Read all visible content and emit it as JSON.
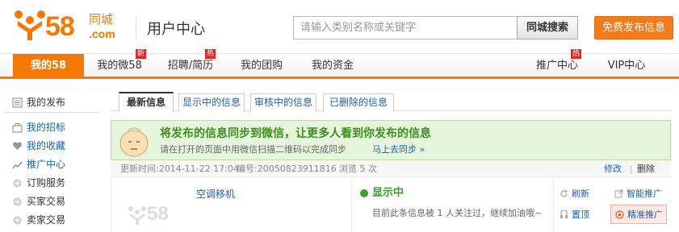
{
  "logo": {
    "number": "58",
    "cn": "同城",
    "com": ".com"
  },
  "header": {
    "page_title": "用户中心",
    "search_placeholder": "请输入类别名称或关键字",
    "search_button": "同城搜索",
    "post_button": "免费发布信息"
  },
  "nav": {
    "items": [
      {
        "label": "我的58"
      },
      {
        "label": "我的微58",
        "badge": "新"
      },
      {
        "label": "招聘/简历",
        "badge": "热"
      },
      {
        "label": "我的团购"
      },
      {
        "label": "我的资金"
      },
      {
        "label": "推广中心",
        "badge": "热"
      },
      {
        "label": "VIP中心"
      }
    ]
  },
  "sidebar": {
    "items": [
      {
        "label": "我的发布",
        "icon": "list-icon"
      },
      {
        "label": "我的招标",
        "icon": "briefcase-icon"
      },
      {
        "label": "我的收藏",
        "icon": "heart-icon"
      },
      {
        "label": "推广中心",
        "icon": "chart-icon"
      },
      {
        "label": "订购服务",
        "icon": "plus-icon"
      },
      {
        "label": "买家交易",
        "icon": "plus-icon"
      },
      {
        "label": "卖家交易",
        "icon": "plus-icon"
      }
    ]
  },
  "tabs": [
    {
      "label": "最新信息"
    },
    {
      "label": "显示中的信息"
    },
    {
      "label": "审核中的信息"
    },
    {
      "label": "已删除的信息"
    }
  ],
  "banner": {
    "headline": "将发布的信息同步到微信，让更多人看到你发布的信息",
    "sub": "请在打开的页面中用微信扫描二维码以完成同步",
    "link": "马上去同步 »"
  },
  "info_bar": {
    "updated": "更新时间:2014-11-22 17:04",
    "number": "编号:20050823911816",
    "views": "浏览 5 次",
    "edit": "修改",
    "separator": "|",
    "delete": "删除"
  },
  "listing": {
    "thumb_text": "58",
    "title": "空调移机",
    "status": "显示中",
    "status_desc": "目前此条信息被 1 人关注过，继续加油哦~",
    "actions": {
      "refresh": "刷新",
      "top": "置顶",
      "smart": "智能推广",
      "precise": "精准推广"
    }
  },
  "colors": {
    "brand": "#f57900",
    "link": "#1961b5",
    "status_green": "#3a9b24",
    "banner_bg": "#e6f6dd"
  }
}
